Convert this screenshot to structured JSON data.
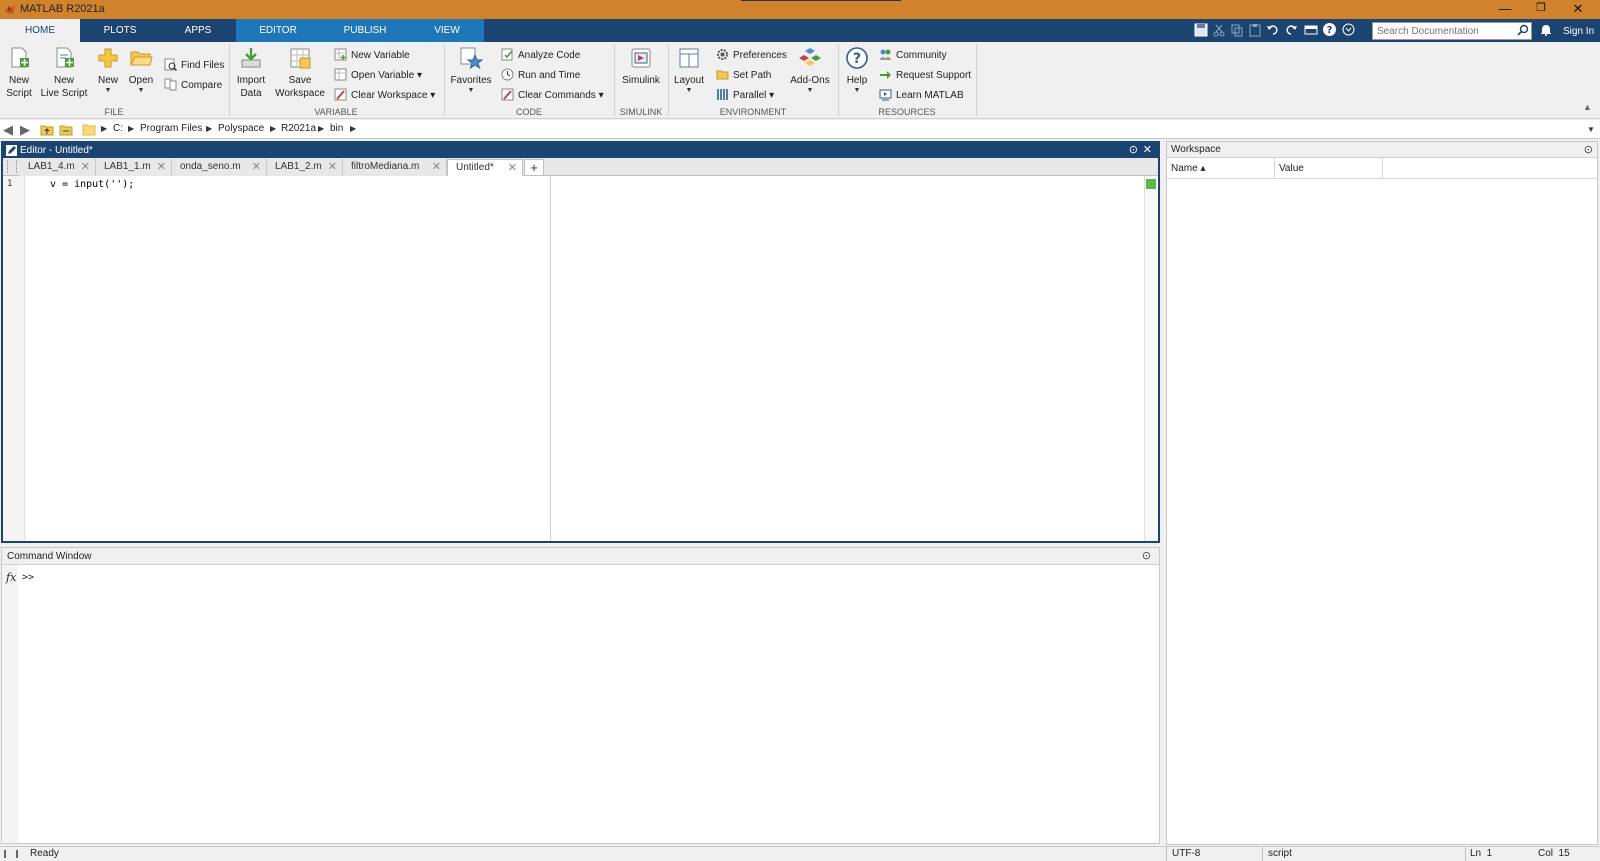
{
  "window": {
    "title": "MATLAB R2021a",
    "controls": {
      "minimize": "—",
      "restore": "❐",
      "close": "✕"
    }
  },
  "ribbon_tabs": [
    {
      "label": "HOME"
    },
    {
      "label": "PLOTS"
    },
    {
      "label": "APPS"
    },
    {
      "label": "EDITOR"
    },
    {
      "label": "PUBLISH"
    },
    {
      "label": "VIEW"
    }
  ],
  "search": {
    "placeholder": "Search Documentation"
  },
  "account": {
    "sign_in": "Sign In"
  },
  "ribbon": {
    "file": {
      "label": "FILE",
      "new_script": "New\nScript",
      "new_live_script": "New\nLive Script",
      "new": "New",
      "open": "Open",
      "find_files": "Find Files",
      "compare": "Compare"
    },
    "variable": {
      "label": "VARIABLE",
      "import_data": "Import\nData",
      "save_workspace": "Save\nWorkspace",
      "new_variable": "New Variable",
      "open_variable": "Open Variable ▾",
      "clear_workspace": "Clear Workspace ▾"
    },
    "code": {
      "label": "CODE",
      "favorites": "Favorites",
      "analyze_code": "Analyze Code",
      "run_and_time": "Run and Time",
      "clear_commands": "Clear Commands ▾"
    },
    "simulink": {
      "label": "SIMULINK",
      "simulink": "Simulink"
    },
    "environment": {
      "label": "ENVIRONMENT",
      "layout": "Layout",
      "preferences": "Preferences",
      "set_path": "Set Path",
      "parallel": "Parallel ▾",
      "add_ons": "Add-Ons"
    },
    "resources": {
      "label": "RESOURCES",
      "help": "Help",
      "community": "Community",
      "request_support": "Request Support",
      "learn_matlab": "Learn MATLAB"
    }
  },
  "address": {
    "path": [
      "C:",
      "Program Files",
      "Polyspace",
      "R2021a",
      "bin"
    ]
  },
  "editor": {
    "title": "Editor - Untitled*",
    "tabs": [
      {
        "label": "LAB1_4.m"
      },
      {
        "label": "LAB1_1.m"
      },
      {
        "label": "onda_seno.m"
      },
      {
        "label": "LAB1_2.m"
      },
      {
        "label": "filtroMediana.m"
      },
      {
        "label": "Untitled*"
      }
    ],
    "add_tab": "+",
    "line_number": "1",
    "code": "v = input('');"
  },
  "command_window": {
    "title": "Command Window",
    "fx": "fx",
    "prompt": ">>"
  },
  "workspace": {
    "title": "Workspace",
    "columns": [
      "Name ▴",
      "Value"
    ]
  },
  "status": {
    "text": "Ready",
    "encoding": "UTF-8",
    "type": "script",
    "line": "Ln  1",
    "col": "Col  15"
  },
  "colors": {
    "title_bar": "#d1822c",
    "tab_strip": "#1b4471",
    "editor_tab_group": "#1f76b9"
  }
}
